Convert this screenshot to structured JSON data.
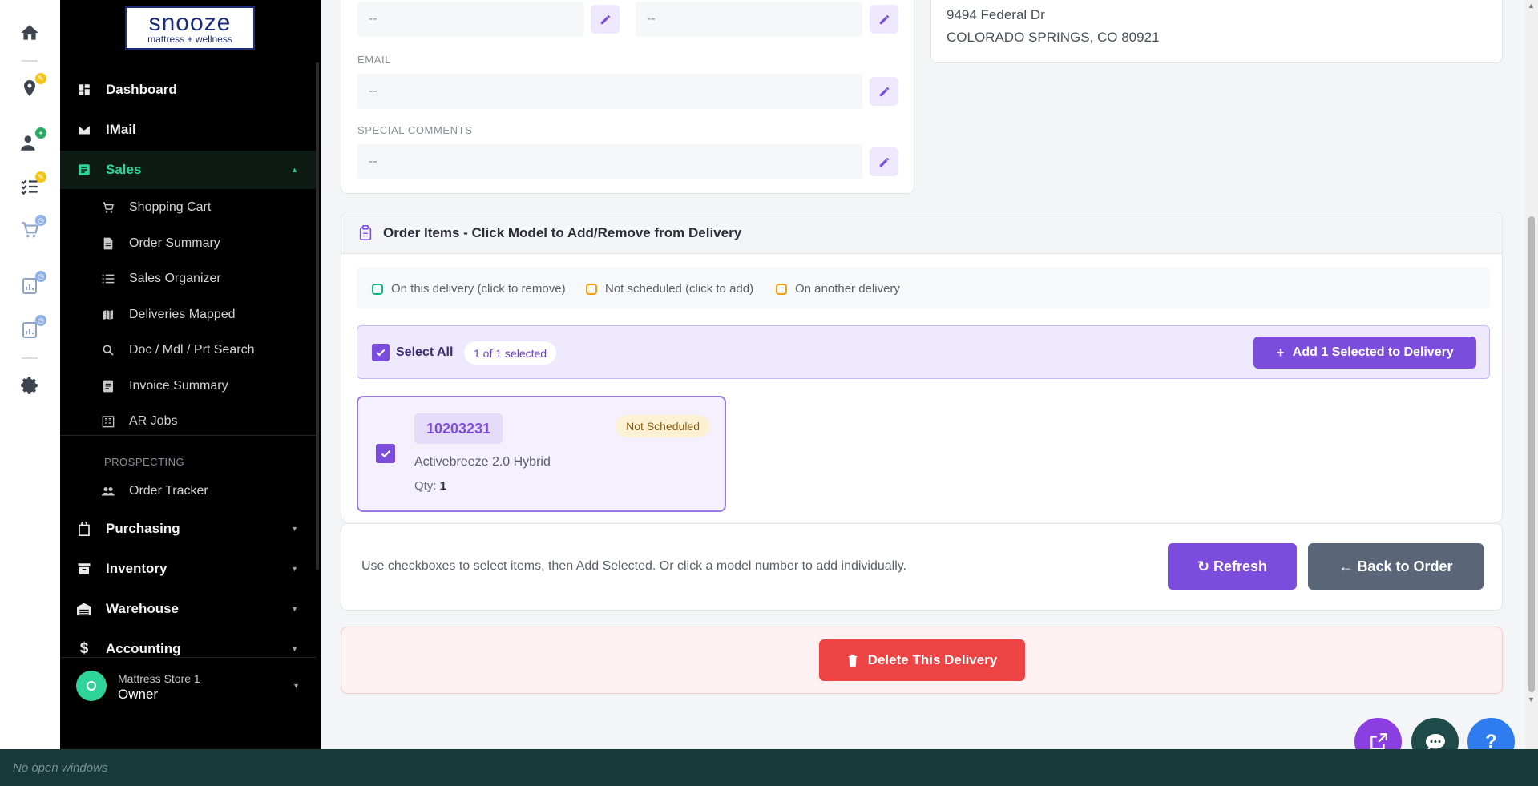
{
  "logo": {
    "main": "snooze",
    "sub": "mattress + wellness"
  },
  "sidebar": {
    "nav": [
      {
        "label": "Dashboard",
        "icon": "dashboard-icon"
      },
      {
        "label": "IMail",
        "icon": "mail-icon"
      },
      {
        "label": "Sales",
        "icon": "receipt-icon",
        "active": true
      }
    ],
    "sales_sub": [
      {
        "label": "Shopping Cart",
        "icon": "cart-icon"
      },
      {
        "label": "Order Summary",
        "icon": "document-icon"
      },
      {
        "label": "Sales Organizer",
        "icon": "list-icon"
      },
      {
        "label": "Deliveries Mapped",
        "icon": "map-icon"
      },
      {
        "label": "Doc / Mdl / Prt Search",
        "icon": "search-icon"
      },
      {
        "label": "Invoice Summary",
        "icon": "invoice-icon"
      },
      {
        "label": "AR Jobs",
        "icon": "building-icon"
      }
    ],
    "prospecting_label": "PROSPECTING",
    "prospecting": [
      {
        "label": "Order Tracker",
        "icon": "people-icon"
      }
    ],
    "nav_bottom": [
      {
        "label": "Purchasing",
        "icon": "bag-icon"
      },
      {
        "label": "Inventory",
        "icon": "archive-icon"
      },
      {
        "label": "Warehouse",
        "icon": "warehouse-icon"
      },
      {
        "label": "Accounting",
        "icon": "dollar-icon"
      }
    ],
    "user": {
      "store": "Mattress Store 1",
      "role": "Owner"
    }
  },
  "customer": {
    "phone1_value": "--",
    "phone2_value": "--",
    "email_label": "EMAIL",
    "email_value": "--",
    "comments_label": "SPECIAL COMMENTS",
    "comments_value": "--",
    "address_line1": "9494 Federal Dr",
    "address_line2": "COLORADO SPRINGS, CO 80921"
  },
  "order_items": {
    "title": "Order Items - Click Model to Add/Remove from Delivery",
    "legend": [
      {
        "label": "On this delivery (click to remove)",
        "color": "#10b981"
      },
      {
        "label": "Not scheduled (click to add)",
        "color": "#f59e0b"
      },
      {
        "label": "On another delivery",
        "color": "#f59e0b"
      }
    ],
    "select_all_label": "Select All",
    "selected_count": "1 of 1 selected",
    "add_selected_button": "Add 1 Selected to Delivery",
    "items": [
      {
        "model": "10203231",
        "status": "Not Scheduled",
        "description": "Activebreeze 2.0 Hybrid",
        "qty_label": "Qty:",
        "qty": "1",
        "checked": true
      }
    ]
  },
  "footer": {
    "hint": "Use checkboxes to select items, then Add Selected. Or click a model number to add individually.",
    "refresh_button": "↻ Refresh",
    "back_button": "← Back to Order"
  },
  "delete_button": "Delete This Delivery",
  "taskbar": {
    "text": "No open windows"
  },
  "colors": {
    "accent": "#7c4ddc",
    "active_nav": "#2ed49a",
    "danger": "#ef4444"
  }
}
